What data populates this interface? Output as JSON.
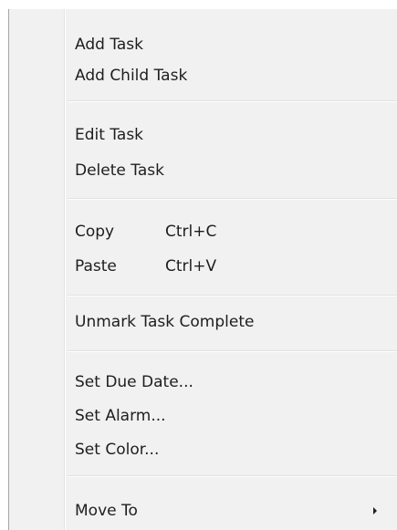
{
  "menu": {
    "add_task": "Add Task",
    "add_child_task": "Add Child Task",
    "edit_task": "Edit Task",
    "delete_task": "Delete Task",
    "copy": "Copy",
    "copy_shortcut": "Ctrl+C",
    "paste": "Paste",
    "paste_shortcut": "Ctrl+V",
    "unmark_task_complete": "Unmark Task Complete",
    "set_due_date": "Set Due Date...",
    "set_alarm": "Set Alarm...",
    "set_color": "Set Color...",
    "move_to": "Move To"
  },
  "icons": {
    "submenu_arrow": "chevron-right-icon"
  },
  "colors": {
    "menu_background": "#f1f1f1",
    "text": "#1e1e1e",
    "separator": "#e0e0e0",
    "border": "#a6a6a6"
  }
}
